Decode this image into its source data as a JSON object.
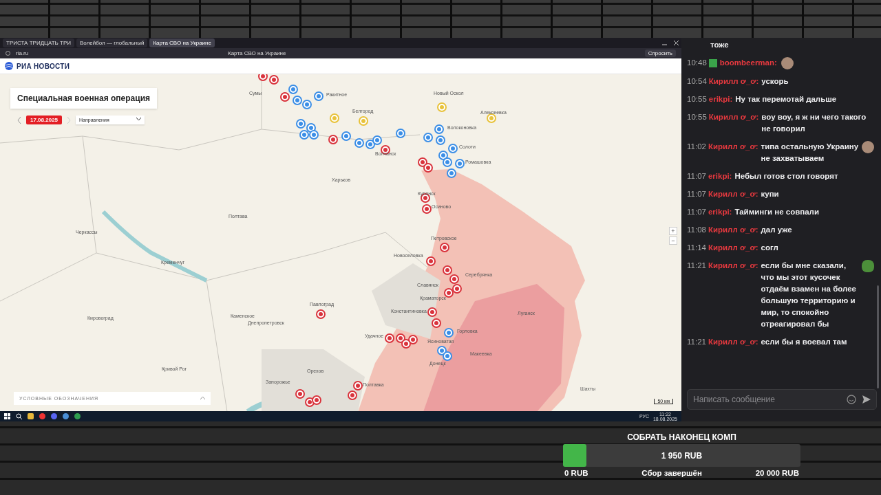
{
  "browser": {
    "tabs": [
      {
        "title": "ТРИСТА ТРИДЦАТЬ ТРИ",
        "selected": false
      },
      {
        "title": "Волейбол — глобальный",
        "selected": false
      },
      {
        "title": "Карта СВО на Украине",
        "selected": true
      }
    ],
    "address": "ria.ru",
    "page_title": "Карта СВО на Украине",
    "ask_button": "Спросить"
  },
  "site": {
    "logo": "РИА НОВОСТИ",
    "panel_title": "Специальная военная операция",
    "date": "17.08.2025",
    "directions_select": "Направления",
    "legend": "УСЛОВНЫЕ ОБОЗНАЧЕНИЯ",
    "scale": "50 км",
    "zoom_in": "+",
    "zoom_out": "−"
  },
  "map_labels": [
    "Сумы",
    "Ракитное",
    "Белгород",
    "Новый Оскол",
    "Алексеевка",
    "Волоконовка",
    "Солоти",
    "Ромашовка",
    "Волчанск",
    "Харьков",
    "Купянск",
    "Осиново",
    "Полтава",
    "Черкассы",
    "Кременчуг",
    "Петровское",
    "Новоселовка",
    "Серебрянка",
    "Славянск",
    "Краматорск",
    "Луганск",
    "Павлоград",
    "Днепропетровск",
    "Каменское",
    "Кировоград",
    "Константиновка",
    "Горловка",
    "Удачное",
    "Ясиноватая",
    "Макеевка",
    "Донецк",
    "Запорожье",
    "Орехов",
    "Полтавка",
    "Кривой Рог",
    "Шахты"
  ],
  "taskbar": {
    "language": "РУС",
    "time": "11:22",
    "date": "18.08.2025"
  },
  "chat": {
    "messages": [
      {
        "kind": "continuation",
        "text": "тоже"
      },
      {
        "kind": "message",
        "time": "10:48",
        "badge": true,
        "user": "boombeerman:",
        "emote": {
          "kind": "face"
        }
      },
      {
        "kind": "message",
        "time": "10:54",
        "badge": false,
        "user": "Кирилл ơ_ơ:",
        "text": "ускорь"
      },
      {
        "kind": "message",
        "time": "10:55",
        "badge": false,
        "user": "erikpi:",
        "text": "Ну так перемотай дальше"
      },
      {
        "kind": "message",
        "time": "10:55",
        "badge": false,
        "user": "Кирилл ơ_ơ:",
        "text": "воу воу, я ж ни чего такого не говорил"
      },
      {
        "kind": "message",
        "time": "11:02",
        "badge": false,
        "user": "Кирилл ơ_ơ:",
        "text": "типа остальную Украину не захватываем",
        "emote": {
          "kind": "face"
        }
      },
      {
        "kind": "message",
        "time": "11:07",
        "badge": false,
        "user": "erikpi:",
        "text": "Небыл готов стол говорят"
      },
      {
        "kind": "message",
        "time": "11:07",
        "badge": false,
        "user": "Кирилл ơ_ơ:",
        "text": "купи"
      },
      {
        "kind": "message",
        "time": "11:07",
        "badge": false,
        "user": "erikpi:",
        "text": "Тайминги не совпали"
      },
      {
        "kind": "message",
        "time": "11:08",
        "badge": false,
        "user": "Кирилл ơ_ơ:",
        "text": "дал уже"
      },
      {
        "kind": "message",
        "time": "11:14",
        "badge": false,
        "user": "Кирилл ơ_ơ:",
        "text": "согл"
      },
      {
        "kind": "message",
        "time": "11:21",
        "badge": false,
        "user": "Кирилл ơ_ơ:",
        "text": "если бы мне сказали, что мы этот кусочек отдаём взамен на более большую территорию и мир, то спокойно отреагировал бы",
        "emote": {
          "kind": "frog"
        }
      },
      {
        "kind": "message",
        "time": "11:21",
        "badge": false,
        "user": "Кирилл ơ_ơ:",
        "text": "если бы я воевал там"
      }
    ],
    "input": {
      "placeholder": "Написать сообщение"
    }
  },
  "goal": {
    "title": "СОБРАТЬ НАКОНЕЦ КОМП",
    "level": 0.0975,
    "raised": "1 950 RUB",
    "min": "0 RUB",
    "status": "Сбор завершён",
    "target": "20 000 RUB"
  }
}
